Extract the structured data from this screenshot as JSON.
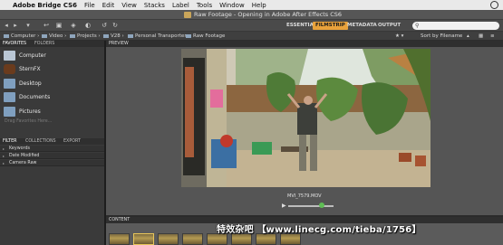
{
  "menubar": {
    "app_name": "Adobe Bridge CS6",
    "items": [
      "File",
      "Edit",
      "View",
      "Stacks",
      "Label",
      "Tools",
      "Window",
      "Help"
    ]
  },
  "window": {
    "title": "Raw Footage - Opening in Adobe After Effects CS6"
  },
  "toolbar": {
    "workspaces": [
      "ESSENTIALS",
      "FILMSTRIP",
      "METADATA",
      "OUTPUT"
    ],
    "active_workspace": "FILMSTRIP",
    "accent_color": "#e9a23b"
  },
  "path": {
    "crumbs": [
      "Computer",
      "Video",
      "Projects",
      "V28",
      "Personal Transporter",
      "Raw Footage"
    ],
    "sort_label": "Sort by Filename"
  },
  "favorites": {
    "tabs": [
      "FAVORITES",
      "FOLDERS"
    ],
    "items": [
      "Computer",
      "SternFX",
      "Desktop",
      "Documents",
      "Pictures"
    ],
    "drag_hint": "Drag Favorites Here..."
  },
  "filter": {
    "tabs": [
      "FILTER",
      "COLLECTIONS",
      "EXPORT"
    ],
    "rows": [
      "Keywords",
      "Date Modified",
      "Camera Raw"
    ]
  },
  "preview": {
    "tab": "PREVIEW",
    "filename": "MVI_7579.MOV"
  },
  "content": {
    "tab": "CONTENT"
  },
  "watermark": "特效杂吧 【www.linecg.com/tieba/1756】"
}
